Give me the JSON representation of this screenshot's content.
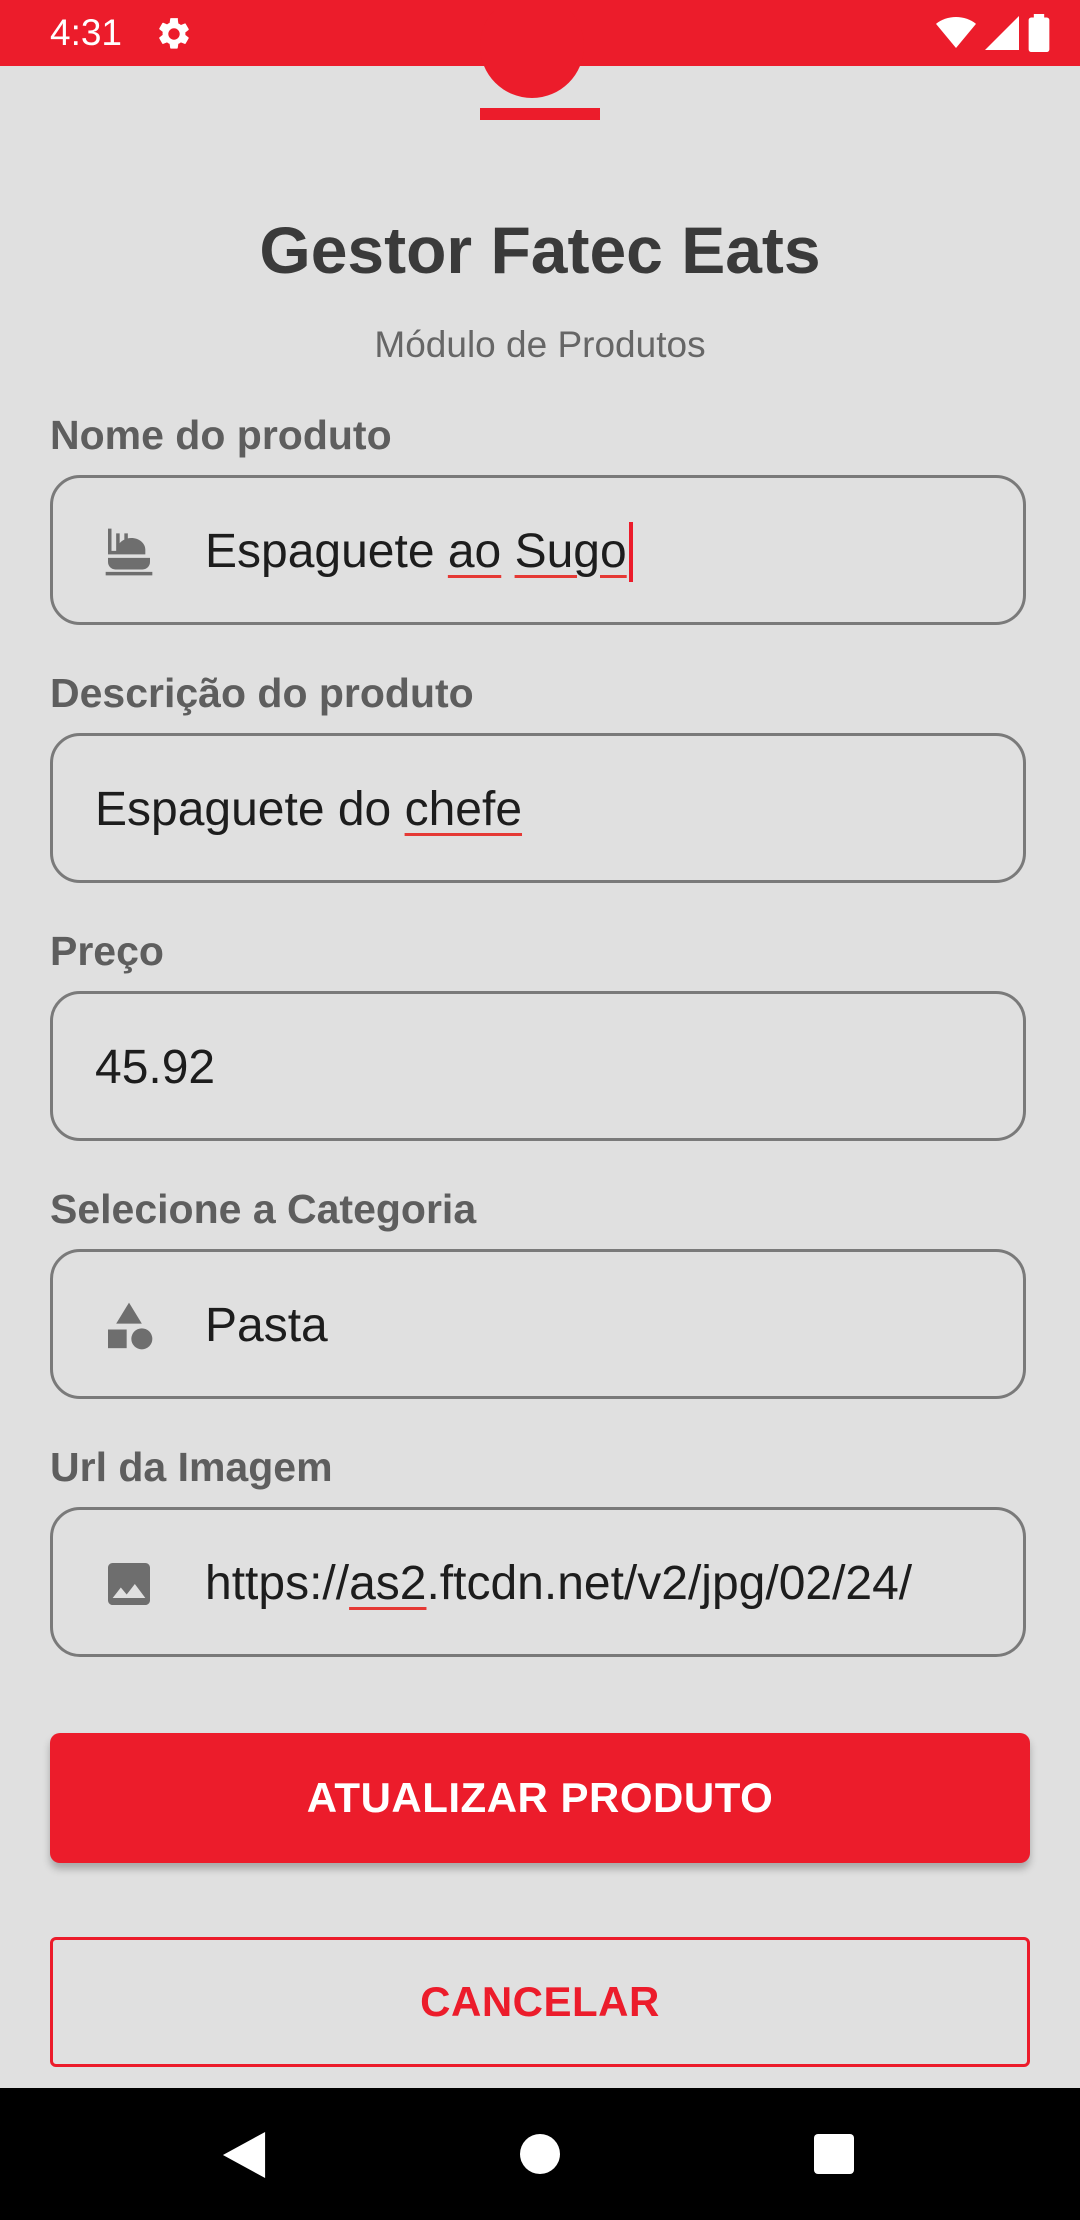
{
  "status_bar": {
    "time": "4:31",
    "background_color": "#ec1c2b",
    "icons": [
      "settings-gear-icon",
      "wifi-icon",
      "cell-signal-icon",
      "battery-icon"
    ]
  },
  "header": {
    "title": "Gestor Fatec Eats",
    "subtitle": "Módulo de Produtos"
  },
  "form": {
    "product_name": {
      "label": "Nome do produto",
      "icon": "dining-icon",
      "value_parts": [
        "Espaguete ",
        "ao",
        " ",
        "Sugo"
      ]
    },
    "product_description": {
      "label": "Descrição do produto",
      "value_parts": [
        "Espaguete do ",
        "chefe"
      ]
    },
    "price": {
      "label": "Preço",
      "value": "45.92"
    },
    "category": {
      "label": "Selecione a Categoria",
      "icon": "category-shapes-icon",
      "value": "Pasta"
    },
    "image_url": {
      "label": "Url da Imagem",
      "icon": "image-icon",
      "value_parts": [
        "https://",
        "as2",
        ".ftcdn.net/v2/jpg/02/24/"
      ]
    }
  },
  "actions": {
    "update_label": "ATUALIZAR PRODUTO",
    "cancel_label": "CANCELAR"
  },
  "colors": {
    "accent": "#ec1c2b",
    "background": "#e0e0e0",
    "text": "#3a3a3a"
  }
}
